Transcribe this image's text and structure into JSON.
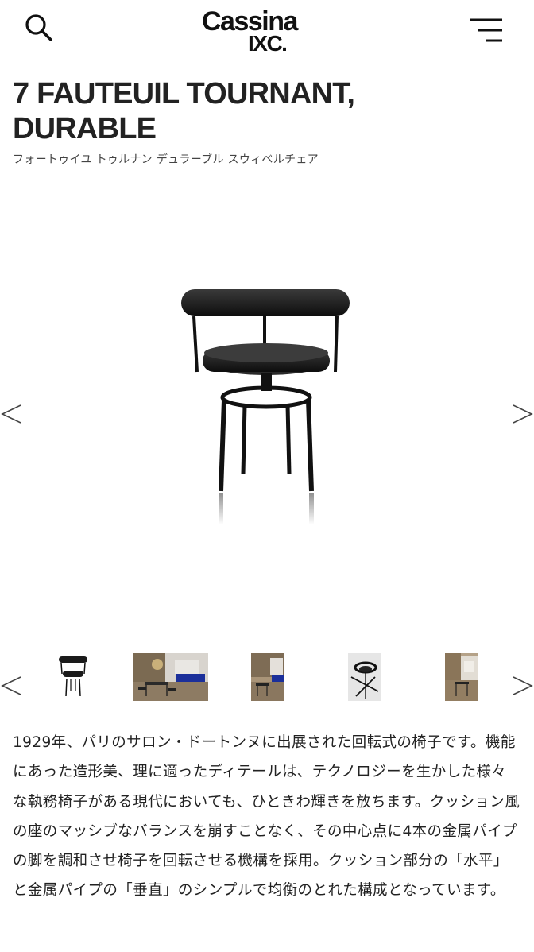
{
  "header": {
    "search_icon": "search-icon",
    "menu_icon": "hamburger-menu-icon",
    "logo": {
      "line1": "Cassina",
      "line2": "IXC."
    }
  },
  "product": {
    "title_line1": "7 FAUTEUIL TOURNANT,",
    "title_line2": "DURABLE",
    "subtitle": "フォートゥイユ トゥルナン デュラーブル スウィベルチェア"
  },
  "gallery": {
    "prev_icon": "chevron-left-icon",
    "next_icon": "chevron-right-icon",
    "thumbnails": [
      "chair-product-photo",
      "living-room-scene",
      "interior-scene",
      "chair-top-view",
      "room-corner-scene"
    ]
  },
  "description": "1929年、パリのサロン・ドートンヌに出展された回転式の椅子です。機能にあった造形美、理に適ったディテールは、テクノロジーを生かした様々な執務椅子がある現代においても、ひときわ輝きを放ちます。クッション風の座のマッシブなバランスを崩すことなく、その中心点に4本の金属パイプの脚を調和させ椅子を回転させる機構を採用。クッション部分の「水平」と金属パイプの「垂直」のシンプルで均衡のとれた構成となっています。"
}
